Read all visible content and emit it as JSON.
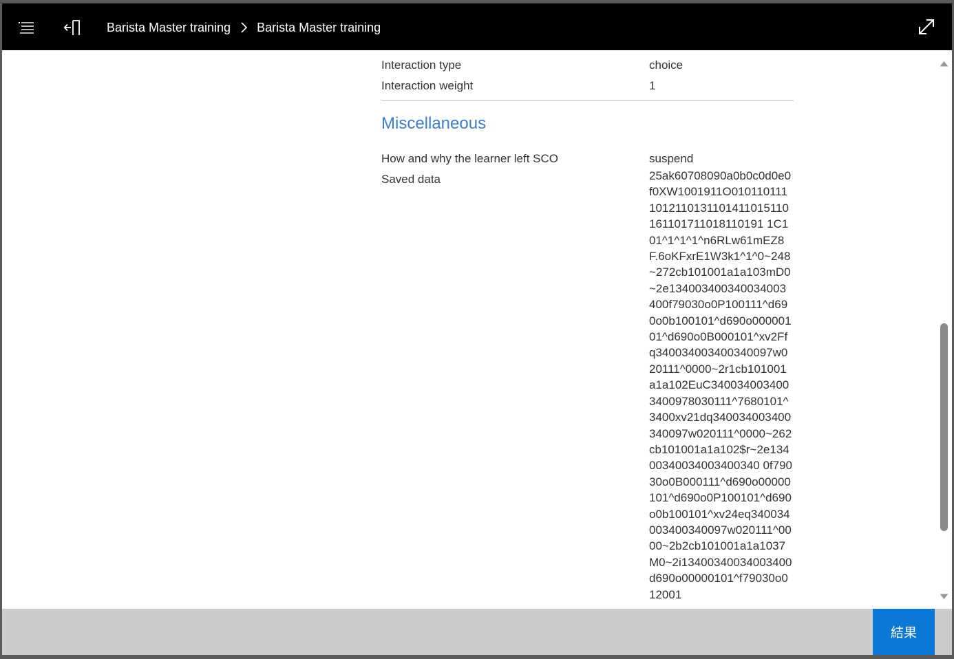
{
  "header": {
    "breadcrumb": [
      "Barista Master training",
      "Barista Master training"
    ],
    "icons": {
      "menu": "list-menu-icon",
      "exit": "exit-icon",
      "expand": "expand-icon",
      "separator": "chevron-right-icon"
    }
  },
  "interaction": {
    "rows": [
      {
        "label": "Interaction type",
        "value": "choice"
      },
      {
        "label": "Interaction weight",
        "value": "1"
      }
    ]
  },
  "miscellaneous": {
    "title": "Miscellaneous",
    "exit_label": "How and why the learner left SCO",
    "exit_value": "suspend",
    "saved_label": "Saved data",
    "saved_value": "25ak60708090a0b0c0d0e0f0XW1001911O0101101111012110131101411015110161101711018110191 1C101^1^1^1^n6RLw61mEZ8F.6oKFxrE1W3k1^1^0~248~272cb101001a1a103mD0~2e134003400340034003400f79030o0P100111^d690o0b100101^d690o00000101^d690o0B000101^xv2Ffq340034003400340097w020111^0000~2r1cb101001a1a102EuC3400340034003400978030111^7680101^3400xv21dq340034003400340097w020111^0000~262cb101001a1a102$r~2e13400340034003400340 0f79030o0B000111^d690o00000101^d690o0P100101^d690o0b100101^xv24eq340034003400340097w020111^0000~2b2cb101001a1a1037M0~2i13400340034003400d690o00000101^f79030o012001"
  },
  "footer": {
    "result_label": "結果"
  },
  "colors": {
    "accent": "#0a78d4",
    "section_title": "#3f7ec4",
    "topbar": "#000000",
    "footer": "#cccccc"
  }
}
